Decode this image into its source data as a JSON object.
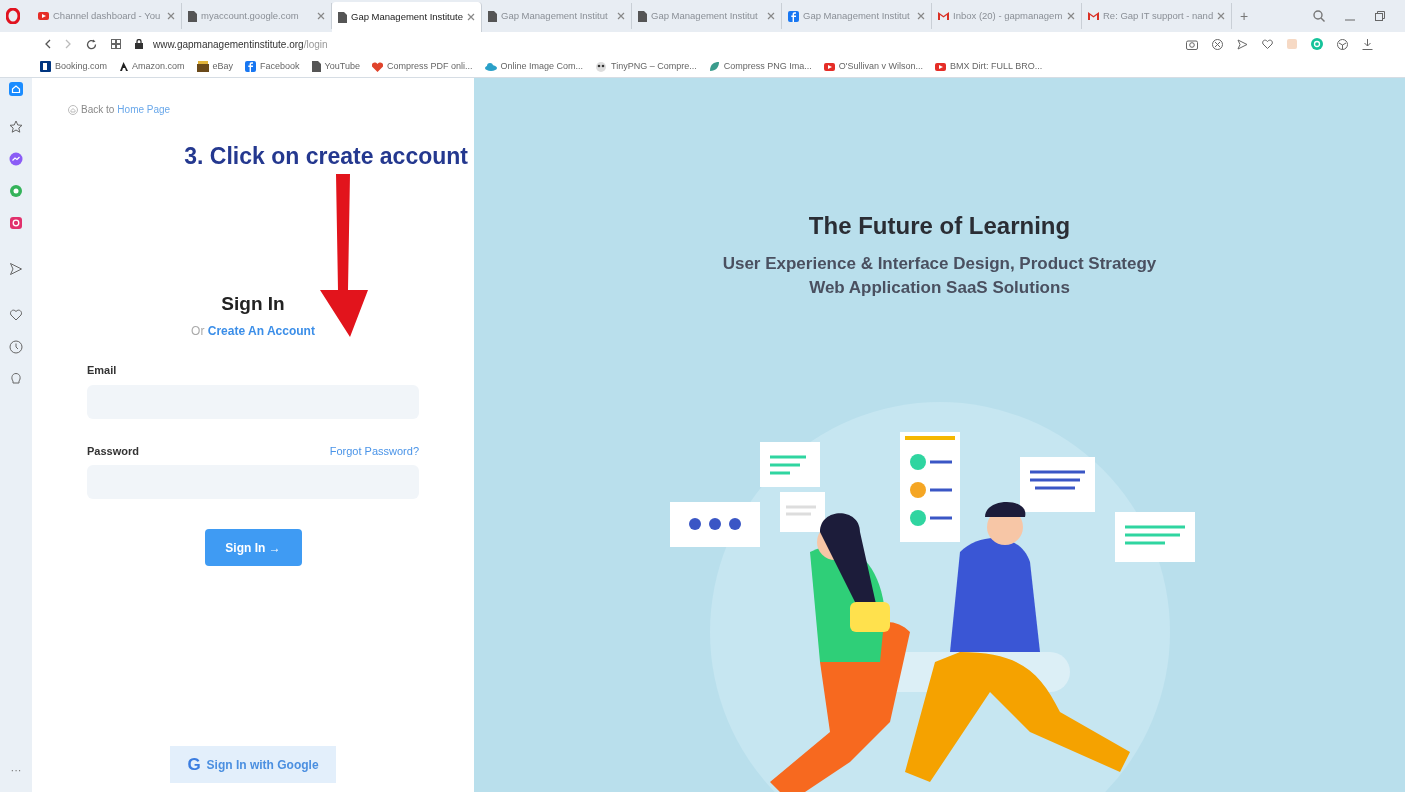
{
  "browser": {
    "tabs": [
      {
        "title": "Channel dashboard - You",
        "kind": "youtube",
        "selected": false
      },
      {
        "title": "myaccount.google.com",
        "kind": "page",
        "selected": false
      },
      {
        "title": "Gap Management Institute",
        "kind": "page",
        "selected": true
      },
      {
        "title": "Gap Management Institut",
        "kind": "page",
        "selected": false
      },
      {
        "title": "Gap Management Institut",
        "kind": "page",
        "selected": false
      },
      {
        "title": "Gap Management Institut",
        "kind": "facebook",
        "selected": false
      },
      {
        "title": "Inbox (20) - gapmanagem",
        "kind": "gmail",
        "selected": false
      },
      {
        "title": "Re: Gap IT support - nand",
        "kind": "gmail",
        "selected": false
      }
    ],
    "new_tab": "+",
    "address": {
      "domain": "www.gapmanagementinstitute.org",
      "path": "/login"
    },
    "bookmarks": [
      {
        "label": "Booking.com",
        "kind": "booking"
      },
      {
        "label": "Amazon.com",
        "kind": "amazon"
      },
      {
        "label": "eBay",
        "kind": "shop"
      },
      {
        "label": "Facebook",
        "kind": "facebook"
      },
      {
        "label": "YouTube",
        "kind": "page"
      },
      {
        "label": "Compress PDF onli...",
        "kind": "heart"
      },
      {
        "label": "Online Image Com...",
        "kind": "cloud"
      },
      {
        "label": "TinyPNG – Compre...",
        "kind": "panda"
      },
      {
        "label": "Compress PNG Ima...",
        "kind": "leaf"
      },
      {
        "label": "O'Sullivan v Wilson...",
        "kind": "youtube"
      },
      {
        "label": "BMX Dirt: FULL BRO...",
        "kind": "youtube"
      }
    ]
  },
  "sidebar": {
    "more": "···"
  },
  "login": {
    "back_prefix": "Back to",
    "back_link": "Home Page",
    "annotation": "3. Click on create account",
    "title": "Sign In",
    "or": "Or",
    "create_link": "Create An Account",
    "email_label": "Email",
    "password_label": "Password",
    "forgot_link": "Forgot Password?",
    "submit": "Sign In →",
    "google": "Sign In with Google",
    "google_mark": "G"
  },
  "hero": {
    "title": "The Future of Learning",
    "subtitle_1": "User Experience & Interface Design, Product Strategy",
    "subtitle_2": "Web Application SaaS Solutions"
  }
}
